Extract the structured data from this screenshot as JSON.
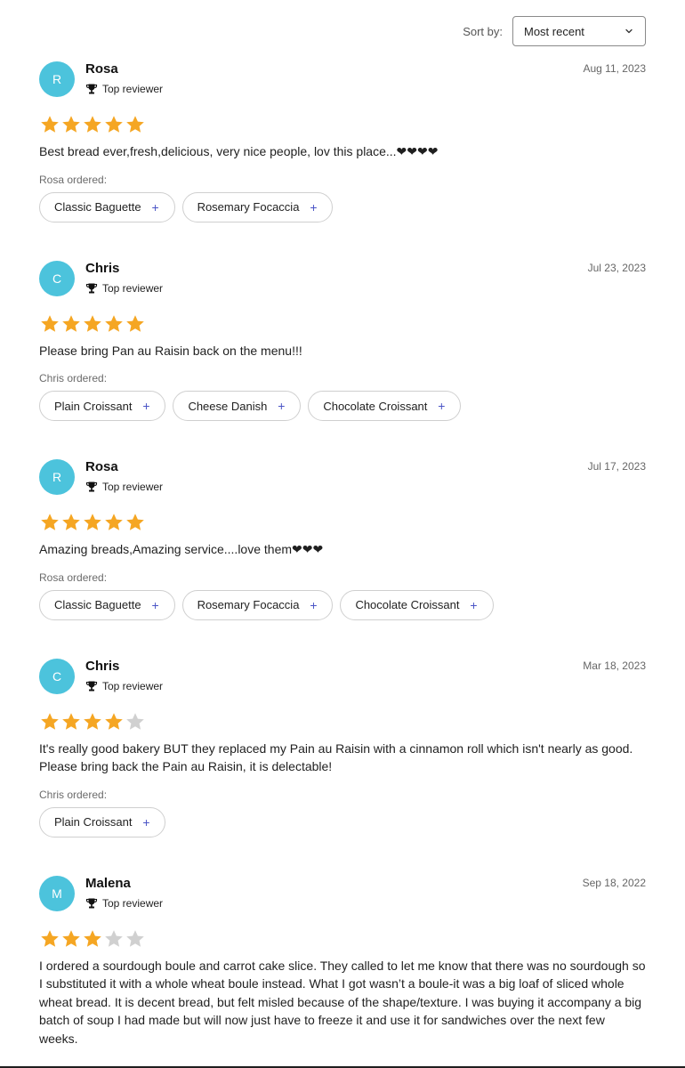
{
  "sort": {
    "label": "Sort by:",
    "selected": "Most recent"
  },
  "colors": {
    "avatar_bg": "#4cc3dc",
    "star_filled": "#f5a623",
    "star_empty": "#d0d0d0",
    "chip_plus": "#4b55c6"
  },
  "reviews": [
    {
      "initial": "R",
      "name": "Rosa",
      "badge": "Top reviewer",
      "date": "Aug 11, 2023",
      "rating": 5,
      "text": "Best bread ever,fresh,delicious, very nice people, lov this place...❤❤❤❤",
      "ordered_label": "Rosa ordered:",
      "items": [
        "Classic Baguette",
        "Rosemary Focaccia"
      ]
    },
    {
      "initial": "C",
      "name": "Chris",
      "badge": "Top reviewer",
      "date": "Jul 23, 2023",
      "rating": 5,
      "text": "Please bring Pan au Raisin back on the menu!!!",
      "ordered_label": "Chris ordered:",
      "items": [
        "Plain Croissant",
        "Cheese Danish",
        "Chocolate Croissant"
      ]
    },
    {
      "initial": "R",
      "name": "Rosa",
      "badge": "Top reviewer",
      "date": "Jul 17, 2023",
      "rating": 5,
      "text": "Amazing breads,Amazing service....love them❤❤❤",
      "ordered_label": "Rosa ordered:",
      "items": [
        "Classic Baguette",
        "Rosemary Focaccia",
        "Chocolate Croissant"
      ]
    },
    {
      "initial": "C",
      "name": "Chris",
      "badge": "Top reviewer",
      "date": "Mar 18, 2023",
      "rating": 4,
      "text": "It's really good bakery BUT they replaced my Pain au Raisin with a cinnamon roll which isn't nearly as good. Please bring back the Pain au Raisin, it is delectable!",
      "ordered_label": "Chris ordered:",
      "items": [
        "Plain Croissant"
      ]
    },
    {
      "initial": "M",
      "name": "Malena",
      "badge": "Top reviewer",
      "date": "Sep 18, 2022",
      "rating": 3,
      "text": "I ordered a sourdough boule and carrot cake slice. They called to let me know that there was no sourdough so I substituted it with a whole wheat boule instead. What I got wasn’t a boule-it was a big loaf of sliced whole wheat bread. It is decent bread, but felt misled because of the shape/texture. I was buying it accompany a big batch of soup I had made but will now just have to freeze it and use it for sandwiches over the next few weeks.",
      "ordered_label": "",
      "items": []
    }
  ]
}
